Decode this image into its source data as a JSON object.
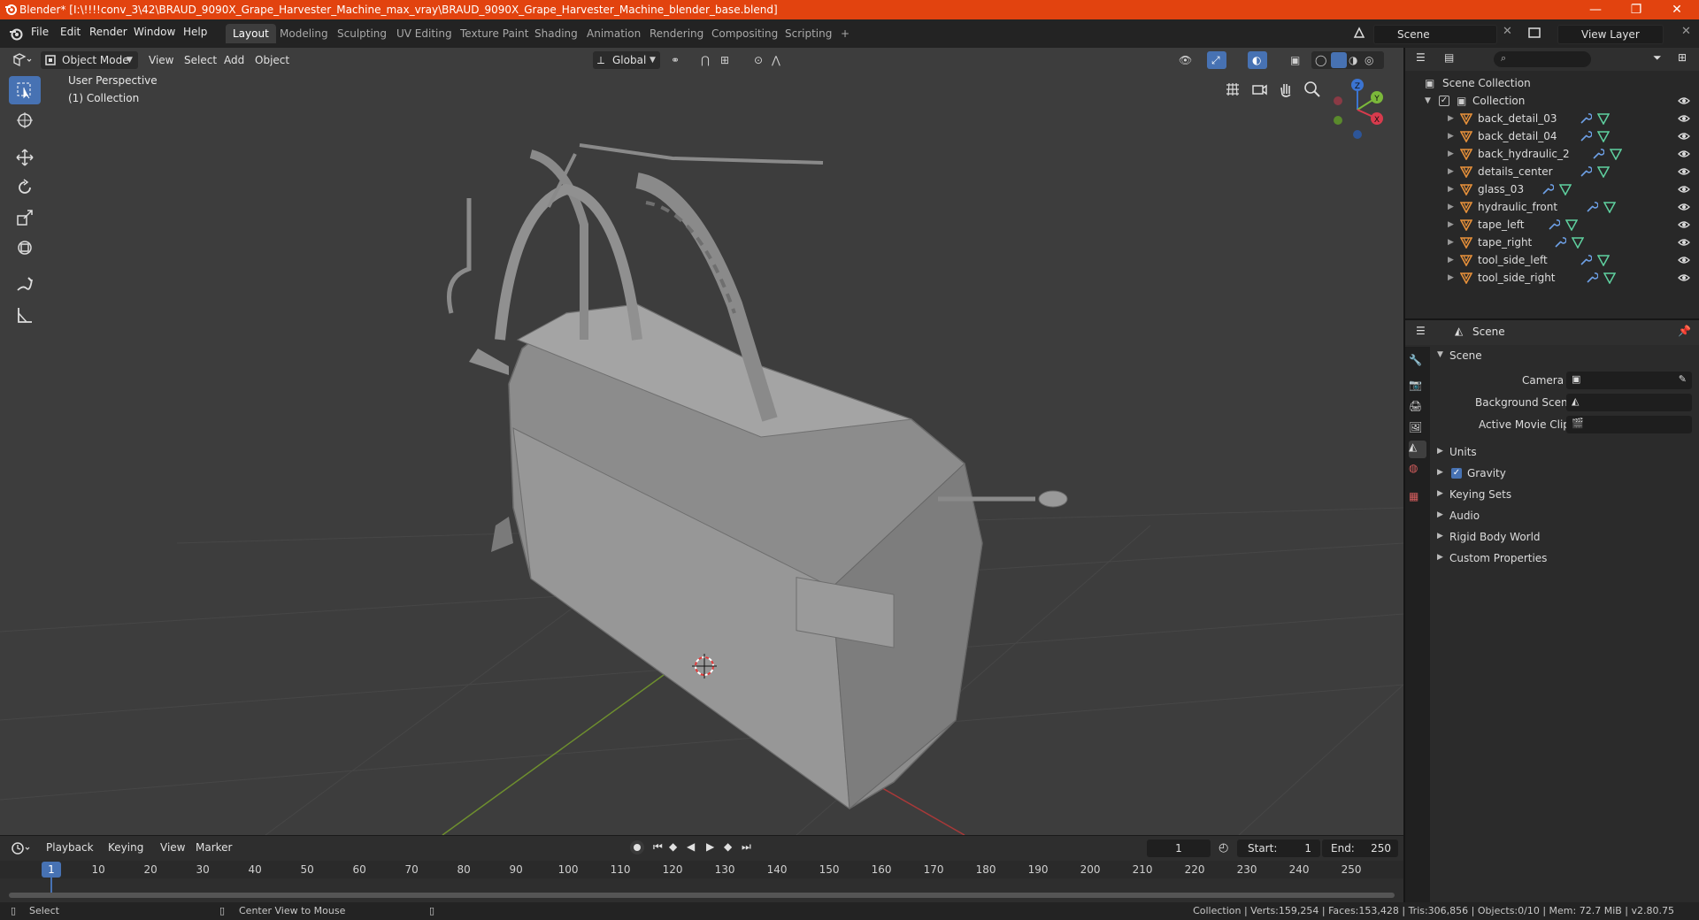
{
  "window": {
    "title": "Blender* [I:\\!!!!conv_3\\42\\BRAUD_9090X_Grape_Harvester_Machine_max_vray\\BRAUD_9090X_Grape_Harvester_Machine_blender_base.blend]",
    "minimize": "—",
    "restore": "❐",
    "close": "✕"
  },
  "menu": [
    "File",
    "Edit",
    "Render",
    "Window",
    "Help"
  ],
  "workspaces": [
    "Layout",
    "Modeling",
    "Sculpting",
    "UV Editing",
    "Texture Paint",
    "Shading",
    "Animation",
    "Rendering",
    "Compositing",
    "Scripting"
  ],
  "workspace_add": "+",
  "scene_field": "Scene",
  "view_layer_field": "View Layer",
  "viewport": {
    "mode": "Object Mode",
    "menus": [
      "View",
      "Select",
      "Add",
      "Object"
    ],
    "transform_orientation": "Global",
    "perspective_label": "User Perspective",
    "collection_label": "(1) Collection",
    "gizmo": {
      "z": "Z",
      "y": "Y",
      "x": "X"
    }
  },
  "timeline": {
    "menus": [
      "Playback",
      "Keying",
      "View",
      "Marker"
    ],
    "current_frame": "1",
    "start_label": "Start:",
    "start_value": "1",
    "end_label": "End:",
    "end_value": "250",
    "ticks": [
      "1",
      "10",
      "20",
      "30",
      "40",
      "50",
      "60",
      "70",
      "80",
      "90",
      "100",
      "110",
      "120",
      "130",
      "140",
      "150",
      "160",
      "170",
      "180",
      "190",
      "200",
      "210",
      "220",
      "230",
      "240",
      "250"
    ]
  },
  "status": {
    "select": "Select",
    "center_view": "Center View to Mouse",
    "stats": "Collection | Verts:159,254 | Faces:153,428 | Tris:306,856 | Objects:0/10 | Mem: 72.7 MiB | v2.80.75"
  },
  "outliner": {
    "root": "Scene Collection",
    "collection": "Collection",
    "objects": [
      "back_detail_03",
      "back_detail_04",
      "back_hydraulic_2",
      "details_center",
      "glass_03",
      "hydraulic_front",
      "tape_left",
      "tape_right",
      "tool_side_left",
      "tool_side_right"
    ]
  },
  "properties": {
    "header": "Scene",
    "section": "Scene",
    "camera_label": "Camera",
    "background_scene_label": "Background Scene",
    "active_movie_clip_label": "Active Movie Clip",
    "panels": [
      "Units",
      "Gravity",
      "Keying Sets",
      "Audio",
      "Rigid Body World",
      "Custom Properties"
    ],
    "gravity_enabled": true
  },
  "colors": {
    "titlebar": "#e2430f",
    "accent": "#4772b3",
    "object_orange": "#e8913a",
    "modifier_blue": "#6ea0e6",
    "mesh_green": "#5fd1a0"
  }
}
